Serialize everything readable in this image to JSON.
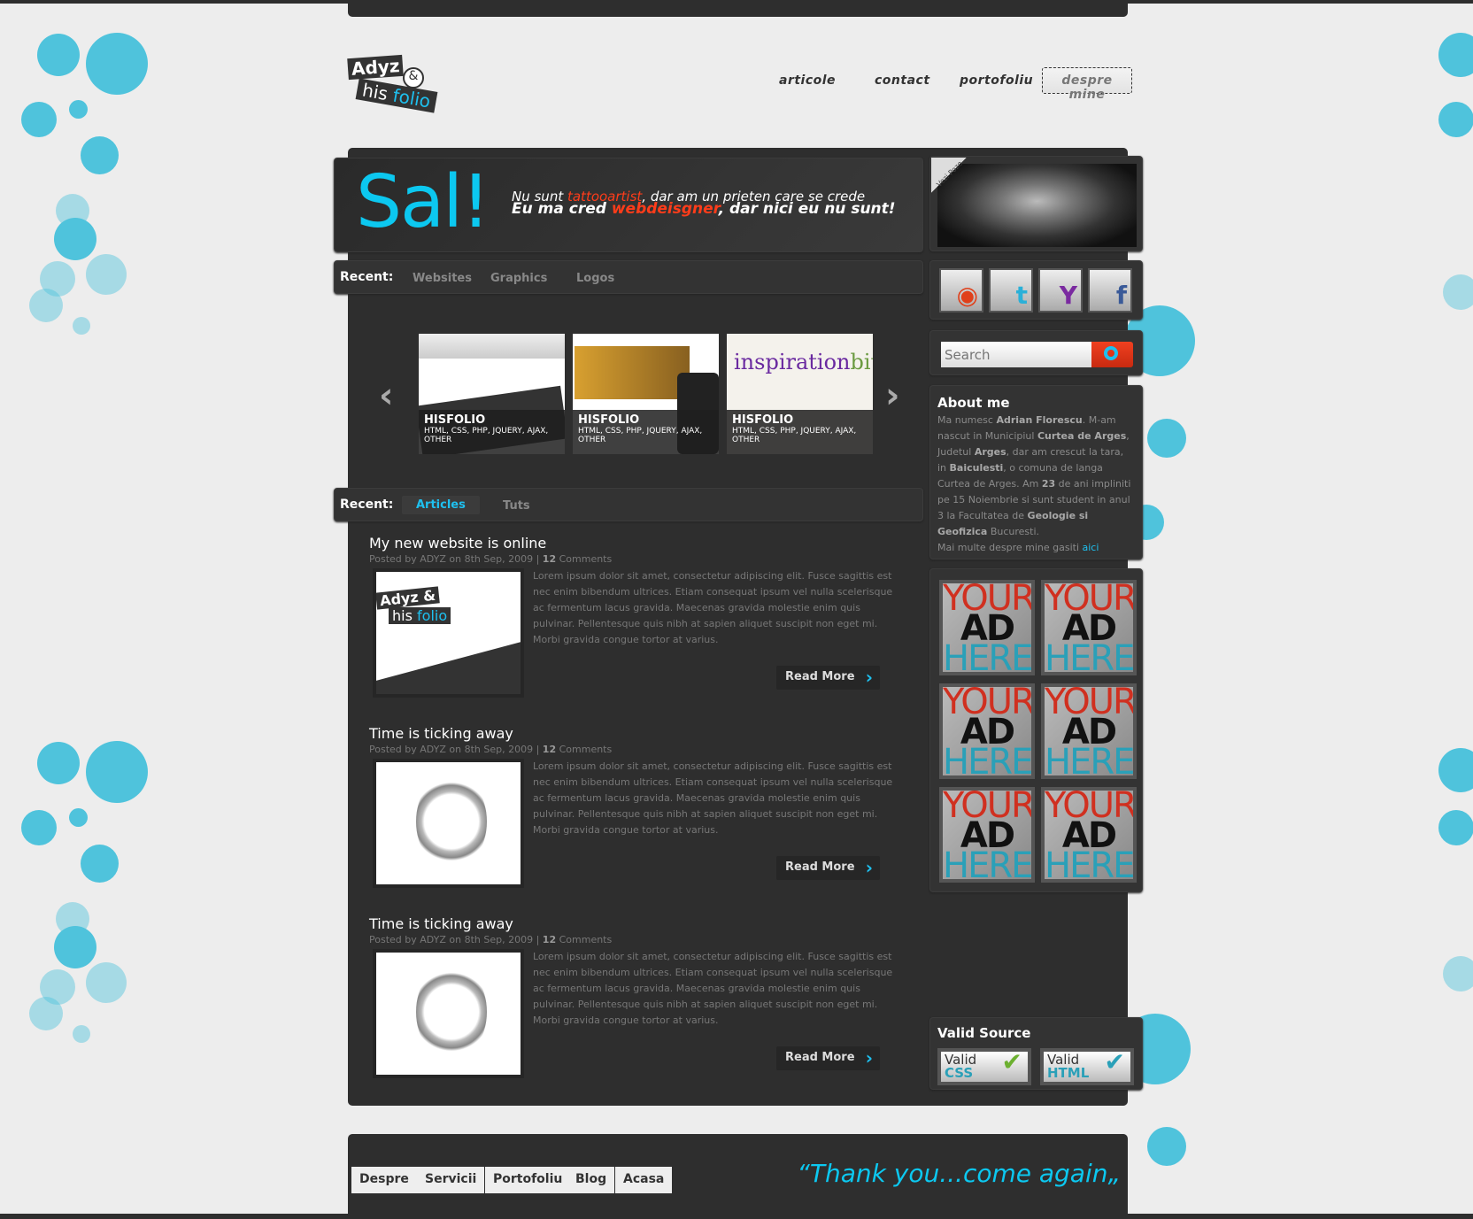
{
  "logo": {
    "line1": "Adyz",
    "amp": "&",
    "line2": "his",
    "line3": "folio"
  },
  "nav": [
    {
      "label": "articole"
    },
    {
      "label": "contact"
    },
    {
      "label": "portofoliu"
    },
    {
      "label": "despre mine",
      "active": true
    }
  ],
  "banner": {
    "greeting": "Sal!",
    "line1_a": "Nu sunt ",
    "line1_red": "tattooartist",
    "line1_b": ", dar am un prieten care se crede",
    "line2_a": "Eu ma cred ",
    "line2_red": "webdeisgner",
    "line2_b": ", dar nici eu nu sunt!",
    "photo_corner": "Vezi Poze"
  },
  "recent_work": {
    "label": "Recent:",
    "tabs": [
      "Websites",
      "Graphics",
      "Logos"
    ],
    "items": [
      {
        "title": "HISFOLIO",
        "tags": "HTML, CSS, PHP, JQUERY, AJAX, OTHER"
      },
      {
        "title": "HISFOLIO",
        "tags": "HTML, CSS, PHP, JQUERY, AJAX, OTHER"
      },
      {
        "title": "HISFOLIO",
        "tags": "HTML, CSS, PHP, JQUERY, AJAX, OTHER"
      }
    ]
  },
  "recent_posts": {
    "label": "Recent:",
    "tabs": [
      "Articles",
      "Tuts"
    ]
  },
  "articles": [
    {
      "title": "My new website is online",
      "meta_a": "Posted by ADYZ on 8th Sep, 2009 | ",
      "comments_n": "12",
      "comments": " Comments",
      "body": "Lorem ipsum dolor sit amet, consectetur adipiscing elit. Fusce sagittis est nec enim bibendum ultrices. Etiam consequat ipsum vel nulla scelerisque ac fermentum lacus gravida. Maecenas gravida molestie enim quis pulvinar. Pellentesque quis nibh at sapien aliquet suscipit non eget mi. Morbi gravida congue tortor at varius.",
      "read_more": "Read More"
    },
    {
      "title": "Time is ticking away",
      "meta_a": "Posted by ADYZ on 8th Sep, 2009 | ",
      "comments_n": "12",
      "comments": " Comments",
      "body": "Lorem ipsum dolor sit amet, consectetur adipiscing elit. Fusce sagittis est nec enim bibendum ultrices. Etiam consequat ipsum vel nulla scelerisque ac fermentum lacus gravida. Maecenas gravida molestie enim quis pulvinar. Pellentesque quis nibh at sapien aliquet suscipit non eget mi. Morbi gravida congue tortor at varius.",
      "read_more": "Read More"
    },
    {
      "title": "Time is ticking away",
      "meta_a": "Posted by ADYZ on 8th Sep, 2009 | ",
      "comments_n": "12",
      "comments": " Comments",
      "body": "Lorem ipsum dolor sit amet, consectetur adipiscing elit. Fusce sagittis est nec enim bibendum ultrices. Etiam consequat ipsum vel nulla scelerisque ac fermentum lacus gravida. Maecenas gravida molestie enim quis pulvinar. Pellentesque quis nibh at sapien aliquet suscipit non eget mi. Morbi gravida congue tortor at varius.",
      "read_more": "Read More"
    }
  ],
  "social": [
    {
      "icon": "rss-icon",
      "glyph": "◉",
      "color": "#e0401a"
    },
    {
      "icon": "twitter-icon",
      "glyph": "t",
      "color": "#2ab0d8"
    },
    {
      "icon": "yahoo-icon",
      "glyph": "Y",
      "color": "#7a2aa0"
    },
    {
      "icon": "facebook-icon",
      "glyph": "f",
      "color": "#3a5a98"
    }
  ],
  "search": {
    "placeholder": "Search"
  },
  "about": {
    "title": "About me",
    "link": "aici"
  },
  "ad": {
    "l1": "YOUR",
    "l2": "AD",
    "l3": "HERE"
  },
  "valid": {
    "title": "Valid Source",
    "css_a": "Valid",
    "css_b": "CSS",
    "html_a": "Valid",
    "html_b": "HTML"
  },
  "footer": {
    "links": [
      "Despre",
      "Servicii",
      "Portofoliu",
      "Blog",
      "Acasa"
    ],
    "quote": "“Thank you...come again„"
  },
  "colors": {
    "accent": "#0cc8f0",
    "red": "#ff3c1a",
    "dark": "#2e2e2e",
    "bubbles": "#4fc3dc"
  }
}
